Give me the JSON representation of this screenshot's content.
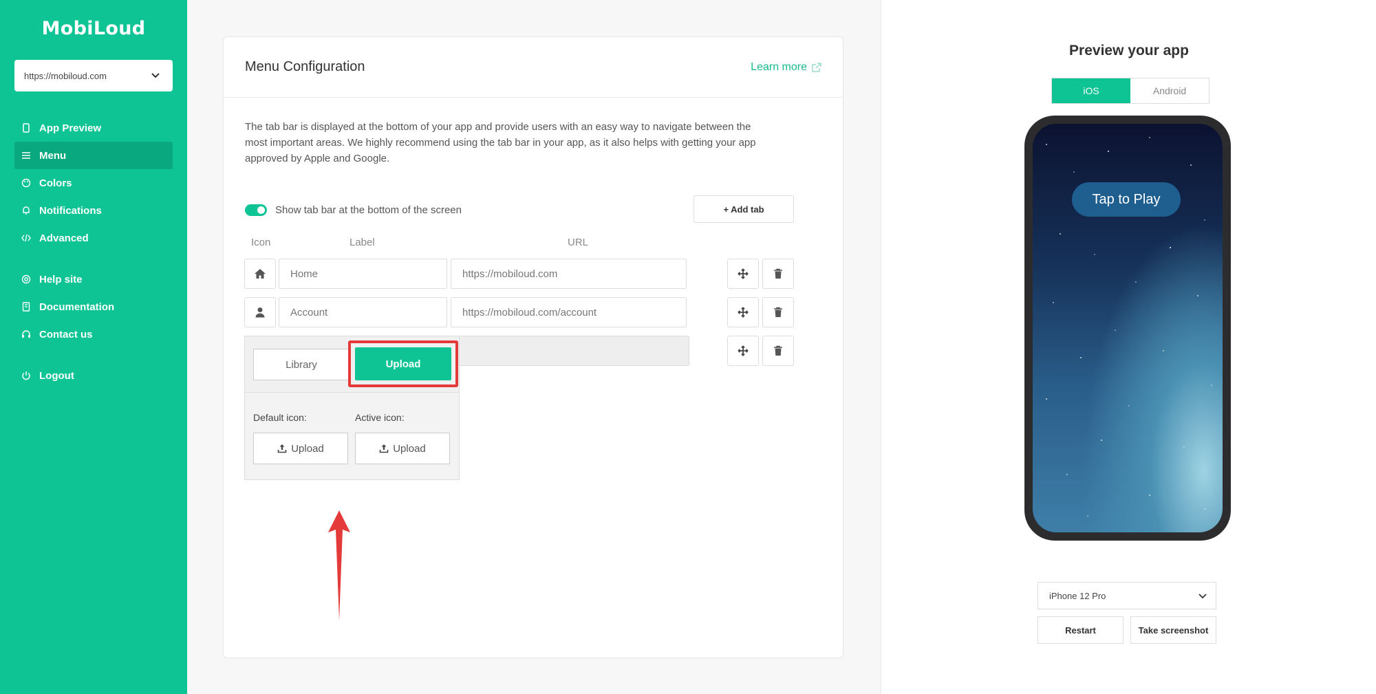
{
  "sidebar": {
    "logo": "MobiLoud",
    "site_select": {
      "value": "https://mobiloud.com"
    },
    "items": [
      {
        "label": "App Preview",
        "icon": "phone-icon"
      },
      {
        "label": "Menu",
        "icon": "menu-icon",
        "active": true
      },
      {
        "label": "Colors",
        "icon": "palette-icon"
      },
      {
        "label": "Notifications",
        "icon": "bell-icon"
      },
      {
        "label": "Advanced",
        "icon": "code-icon"
      }
    ],
    "help_items": [
      {
        "label": "Help site",
        "icon": "lifebuoy-icon"
      },
      {
        "label": "Documentation",
        "icon": "book-icon"
      },
      {
        "label": "Contact us",
        "icon": "headset-icon"
      }
    ],
    "logout": {
      "label": "Logout",
      "icon": "power-icon"
    }
  },
  "main": {
    "title": "Menu Configuration",
    "learn_more": "Learn more",
    "description": "The tab bar is displayed at the bottom of your app and provide users with an easy way to navigate between the most important areas. We highly recommend using the tab bar in your app, as it also helps with getting your app approved by Apple and Google.",
    "toggle_label": "Show tab bar at the bottom of the screen",
    "toggle_on": true,
    "add_tab": "+ Add tab",
    "columns": {
      "icon": "Icon",
      "label": "Label",
      "url": "URL"
    },
    "tabs": [
      {
        "icon": "home-icon",
        "label": "Home",
        "url": "https://mobiloud.com"
      },
      {
        "icon": "user-icon",
        "label": "Account",
        "url": "https://mobiloud.com/account"
      }
    ],
    "icon_picker": {
      "library": "Library",
      "upload": "Upload",
      "default_icon": "Default icon:",
      "active_icon": "Active icon:",
      "upload_default": "Upload",
      "upload_active": "Upload"
    }
  },
  "preview": {
    "title": "Preview your app",
    "platforms": {
      "ios": "iOS",
      "android": "Android",
      "selected": "iOS"
    },
    "tap_to_play": "Tap to Play",
    "device": "iPhone 12 Pro",
    "restart": "Restart",
    "screenshot": "Take screenshot"
  },
  "colors": {
    "brand": "#0ec495",
    "brand_dark": "#0aa87f",
    "highlight": "#e53a3a"
  }
}
